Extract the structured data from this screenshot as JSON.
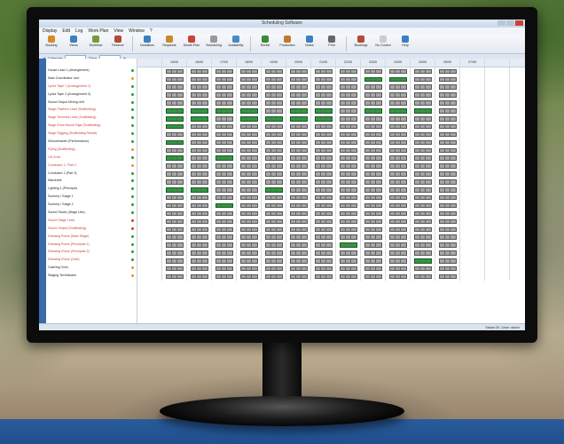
{
  "window": {
    "title": "Scheduling Software"
  },
  "menu": [
    "Display",
    "Edit",
    "Log",
    "Work Plan",
    "View",
    "Window",
    "?"
  ],
  "ribbon": [
    {
      "label": "Booking",
      "color": "#d68a2a"
    },
    {
      "label": "Views",
      "color": "#3b7fc4"
    },
    {
      "label": "Workflow",
      "color": "#7a9a3a"
    },
    {
      "label": "Reserve",
      "color": "#b04a3a"
    },
    {
      "label": "Deadlines",
      "color": "#3b7fc4"
    },
    {
      "label": "Requests",
      "color": "#c78a2a"
    },
    {
      "label": "Month Plan",
      "color": "#c9423a"
    },
    {
      "label": "Scheduling",
      "color": "#999999"
    },
    {
      "label": "Availability",
      "color": "#4a8ac4"
    },
    {
      "label": "Rental",
      "color": "#3a8a3a"
    },
    {
      "label": "Production",
      "color": "#c47a2a"
    },
    {
      "label": "Notes",
      "color": "#3b7fc4"
    },
    {
      "label": "Print",
      "color": "#666666"
    },
    {
      "label": "Bookings",
      "color": "#b04a3a"
    },
    {
      "label": "No Control",
      "color": "#cccccc"
    },
    {
      "label": "Help",
      "color": "#3b7fc4"
    }
  ],
  "filters": {
    "label1": "Calendar",
    "label2": "Days"
  },
  "columns": [
    "",
    "15/05",
    "16/05",
    "17/05",
    "18/05",
    "19/05",
    "20/05",
    "21/05",
    "22/05",
    "23/05",
    "24/05",
    "25/05",
    "26/05",
    "27/05",
    ""
  ],
  "rows": [
    {
      "label": "House Lead 1 (Arrangement)",
      "color": "#222",
      "dot": "#2f9a3f"
    },
    {
      "label": "Main Coordinator Line",
      "color": "#222",
      "dot": "#e0a020"
    },
    {
      "label": "Lyrics Tape 1 (Arrangement 1)",
      "color": "#c9423a",
      "dot": "#2f9a3f"
    },
    {
      "label": "Lyrics Tape 2 (Arrangement 2)",
      "color": "#222",
      "dot": "#2f9a3f"
    },
    {
      "label": "Sound Output Mixing Unit",
      "color": "#222",
      "dot": "#2f9a3f"
    },
    {
      "label": "Stage Platform Lead (Scaffolding)",
      "color": "#c9423a",
      "dot": "#2f9a3f"
    },
    {
      "label": "Stage Technics Lead (Scaffolding)",
      "color": "#c9423a",
      "dot": "#2f9a3f"
    },
    {
      "label": "Stage Extra Sound Rigs (Scaffolding)",
      "color": "#c9423a",
      "dot": "#2f9a3f"
    },
    {
      "label": "Stage Rigging (Scaffolding Rental)",
      "color": "#c9423a",
      "dot": "#2f9a3f"
    },
    {
      "label": "Schoolmaster (Performance)",
      "color": "#222",
      "dot": "#2f9a3f"
    },
    {
      "label": "Flying (Scaffolding)",
      "color": "#c9423a",
      "dot": "#e0a020"
    },
    {
      "label": "Lift Crew",
      "color": "#c9423a",
      "dot": "#2f9a3f"
    },
    {
      "label": "Conductor 1 / Part 2",
      "color": "#c9423a",
      "dot": "#e0a020"
    },
    {
      "label": "Conductor 2 (Part 3)",
      "color": "#222",
      "dot": "#2f9a3f"
    },
    {
      "label": "Wardrobe",
      "color": "#222",
      "dot": "#2f9a3f"
    },
    {
      "label": "Lighting 1 (Principal)",
      "color": "#222",
      "dot": "#2f9a3f"
    },
    {
      "label": "Scenery / Stage 1",
      "color": "#222",
      "dot": "#2f9a3f"
    },
    {
      "label": "Scenery / Stage 2",
      "color": "#222",
      "dot": "#2f9a3f"
    },
    {
      "label": "Sound Studio (Stage Use)",
      "color": "#222",
      "dot": "#2f9a3f"
    },
    {
      "label": "Sound Stage Lead",
      "color": "#c9423a",
      "dot": "#c9423a"
    },
    {
      "label": "Sound Output (Scaffolding)",
      "color": "#c9423a",
      "dot": "#c9423a"
    },
    {
      "label": "Dressing Room (Main Stage)",
      "color": "#c9423a",
      "dot": "#2f9a3f"
    },
    {
      "label": "Dressing Room (Principals 1)",
      "color": "#c9423a",
      "dot": "#2f9a3f"
    },
    {
      "label": "Dressing Room (Principals 2)",
      "color": "#c9423a",
      "dot": "#2f9a3f"
    },
    {
      "label": "Dressing Room (Cast)",
      "color": "#c9423a",
      "dot": "#2f9a3f"
    },
    {
      "label": "Catering Crew",
      "color": "#222",
      "dot": "#e0a020"
    },
    {
      "label": "Staging Technicians",
      "color": "#222",
      "dot": "#e0a020"
    }
  ],
  "status": "Status OK  |  User: admin"
}
